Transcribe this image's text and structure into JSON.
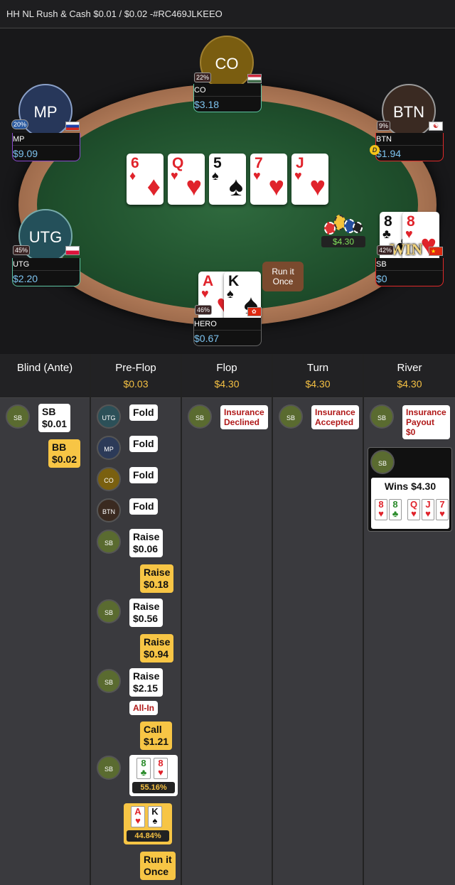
{
  "title": "HH NL Rush & Cash $0.01 / $0.02 -#RC469JLKEEO",
  "board": [
    {
      "rank": "6",
      "suit": "♦",
      "color": "red"
    },
    {
      "rank": "Q",
      "suit": "♥",
      "color": "red"
    },
    {
      "rank": "5",
      "suit": "♠",
      "color": "blk"
    },
    {
      "rank": "7",
      "suit": "♥",
      "color": "red"
    },
    {
      "rank": "J",
      "suit": "♥",
      "color": "red"
    }
  ],
  "pot": "$4.30",
  "seats": {
    "co": {
      "avatar": "CO",
      "name": "CO",
      "stack": "$3.18",
      "pct": "22%"
    },
    "mp": {
      "avatar": "MP",
      "name": "MP",
      "stack": "$9.09",
      "pct": "20%"
    },
    "btn": {
      "avatar": "BTN",
      "name": "BTN",
      "stack": "$1.94",
      "pct": "9%",
      "dealer": "D"
    },
    "utg": {
      "avatar": "UTG",
      "name": "UTG",
      "stack": "$2.20",
      "pct": "45%"
    },
    "sb": {
      "name": "SB",
      "stack": "$0",
      "pct": "42%",
      "win": "WIN",
      "cards": [
        {
          "rank": "8",
          "suit": "♣",
          "color": "blk"
        },
        {
          "rank": "8",
          "suit": "♥",
          "color": "red"
        }
      ]
    },
    "hero": {
      "name": "HERO",
      "stack": "$0.67",
      "pct": "46%",
      "cards": [
        {
          "rank": "A",
          "suit": "♥",
          "color": "red"
        },
        {
          "rank": "K",
          "suit": "♠",
          "color": "blk"
        }
      ]
    }
  },
  "runit": "Run it\nOnce",
  "columns": [
    {
      "title": "Blind (Ante)",
      "pot": ""
    },
    {
      "title": "Pre-Flop",
      "pot": "$0.03"
    },
    {
      "title": "Flop",
      "pot": "$4.30"
    },
    {
      "title": "Turn",
      "pot": "$4.30"
    },
    {
      "title": "River",
      "pot": "$4.30"
    }
  ],
  "actions": {
    "sb_blind": "SB\n$0.01",
    "bb_blind": "BB\n$0.02",
    "utg": "UTG",
    "utg_act": "Fold",
    "mp": "MP",
    "mp_act": "Fold",
    "co": "CO",
    "co_act": "Fold",
    "btn": "BTN",
    "btn_act": "Fold",
    "sb": "SB",
    "a1": "Raise\n$0.06",
    "a2": "Raise\n$0.18",
    "a3": "Raise\n$0.56",
    "a4": "Raise\n$0.94",
    "a5": "Raise\n$2.15",
    "allin": "All-In",
    "a6": "Call\n$1.21",
    "eq1": "55.16%",
    "eq2": "44.84%",
    "runonce": "Run it\nOnce",
    "flop_act": "Insurance\nDeclined",
    "turn_act": "Insurance\nAccepted",
    "river_act": "Insurance\nPayout\n$0",
    "wins": "Wins $4.30",
    "river_cards": [
      {
        "rank": "8",
        "suit": "♥",
        "color": "red"
      },
      {
        "rank": "8",
        "suit": "♣",
        "color": "grn"
      },
      {
        "rank": "Q",
        "suit": "♥",
        "color": "red"
      },
      {
        "rank": "J",
        "suit": "♥",
        "color": "red"
      },
      {
        "rank": "7",
        "suit": "♥",
        "color": "red"
      }
    ]
  }
}
